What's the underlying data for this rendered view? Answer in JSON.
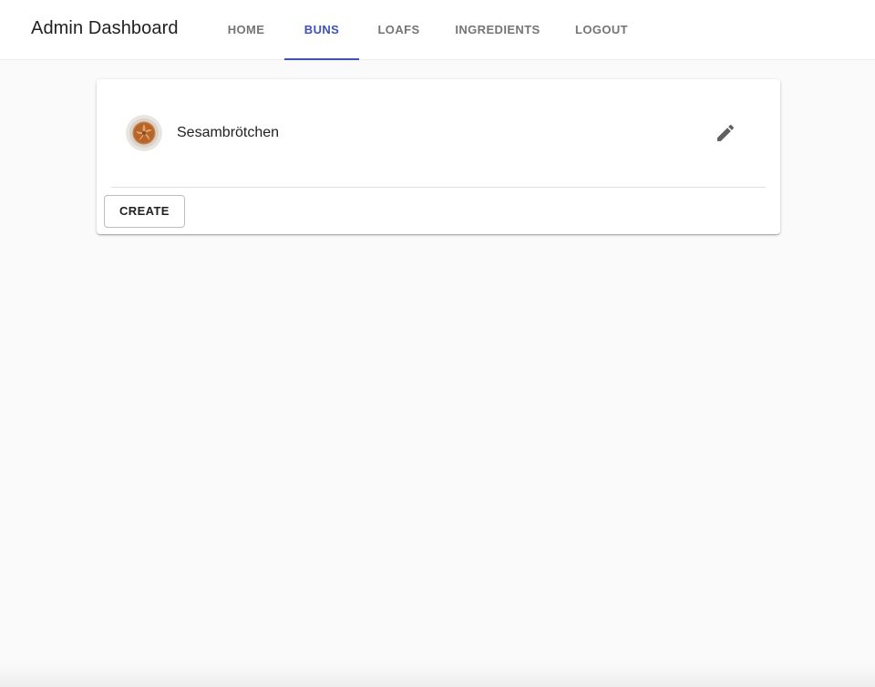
{
  "appbar": {
    "title": "Admin Dashboard",
    "tabs": [
      {
        "label": "HOME",
        "active": false
      },
      {
        "label": "BUNS",
        "active": true
      },
      {
        "label": "LOAFS",
        "active": false
      },
      {
        "label": "INGREDIENTS",
        "active": false
      },
      {
        "label": "LOGOUT",
        "active": false
      }
    ]
  },
  "buns_list": {
    "items": [
      {
        "name": "Sesambrötchen",
        "avatar_icon": "bun-image",
        "action_icon": "pencil-icon"
      }
    ],
    "create_label": "CREATE"
  },
  "colors": {
    "accent": "#3f51b5",
    "background": "#fafafa",
    "card": "#ffffff"
  }
}
